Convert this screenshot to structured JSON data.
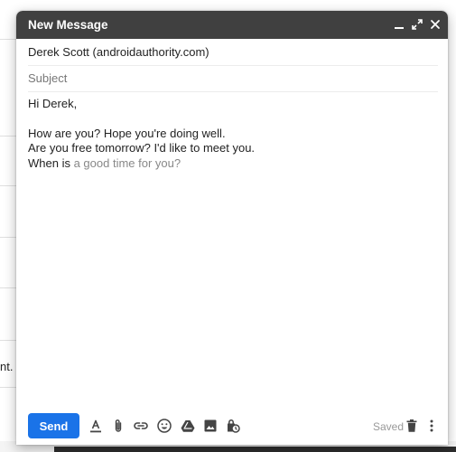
{
  "window": {
    "title": "New Message"
  },
  "compose": {
    "to": "Derek Scott (androidauthority.com)",
    "subject_placeholder": "Subject",
    "body": {
      "greeting": "Hi Derek,",
      "line1": "How are you? Hope you're doing well.",
      "line2": "Are you free tomorrow? I'd like to meet you.",
      "line3_typed": "When is",
      "line3_suggestion": " a good time for you?"
    }
  },
  "footer": {
    "send_label": "Send",
    "status": "Saved"
  },
  "background": {
    "fragment_text": "nt. G"
  },
  "colors": {
    "header_bg": "#404040",
    "send_button": "#1a73e8",
    "icon_gray": "#444444"
  },
  "icons": {
    "header": [
      "minimize-icon",
      "expand-icon",
      "close-icon"
    ],
    "toolbar": [
      "format-text-icon",
      "attach-icon",
      "link-icon",
      "emoji-icon",
      "drive-icon",
      "photo-icon",
      "confidential-icon"
    ],
    "right": [
      "trash-icon",
      "more-options-icon"
    ]
  }
}
